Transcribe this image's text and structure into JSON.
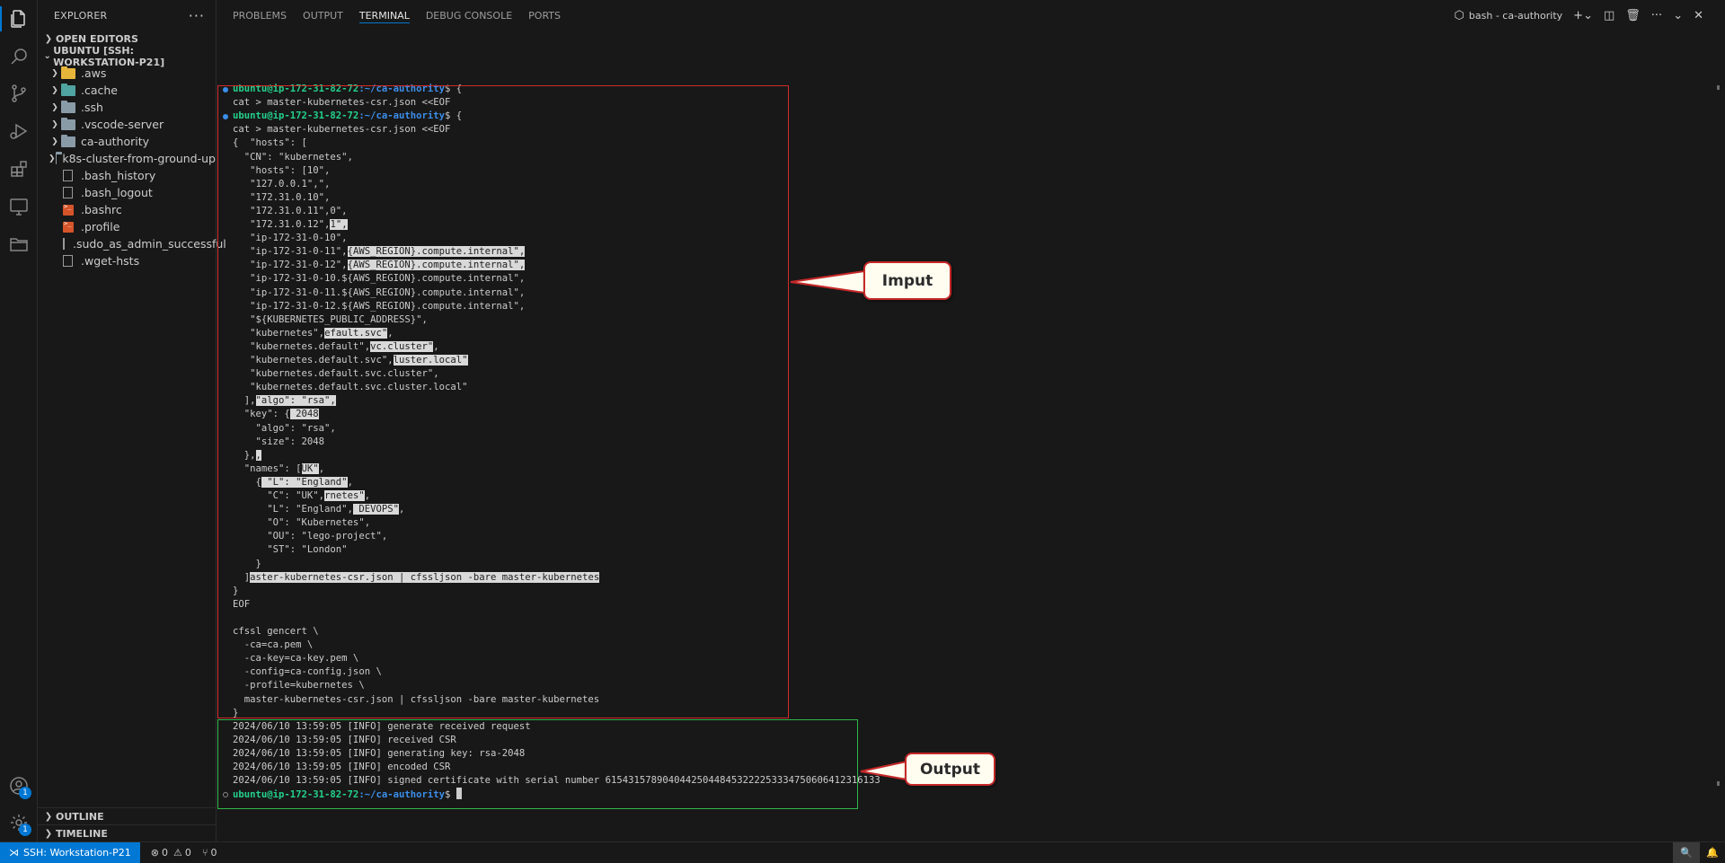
{
  "sidebar": {
    "title": "EXPLORER",
    "open_editors": "OPEN EDITORS",
    "workspace": "UBUNTU [SSH: WORKSTATION-P21]",
    "items": [
      {
        "label": ".aws",
        "kind": "folder",
        "icon": "folder-aws-icon"
      },
      {
        "label": ".cache",
        "kind": "folder",
        "icon": "folder-cache-icon"
      },
      {
        "label": ".ssh",
        "kind": "folder",
        "icon": "folder-icon"
      },
      {
        "label": ".vscode-server",
        "kind": "folder",
        "icon": "folder-icon"
      },
      {
        "label": "ca-authority",
        "kind": "folder",
        "icon": "folder-icon"
      },
      {
        "label": "k8s-cluster-from-ground-up",
        "kind": "folder",
        "icon": "folder-icon"
      },
      {
        "label": ".bash_history",
        "kind": "file",
        "icon": "file-icon"
      },
      {
        "label": ".bash_logout",
        "kind": "file",
        "icon": "file-icon"
      },
      {
        "label": ".bashrc",
        "kind": "shell",
        "icon": "shell-file-icon"
      },
      {
        "label": ".profile",
        "kind": "shell",
        "icon": "shell-file-icon"
      },
      {
        "label": ".sudo_as_admin_successful",
        "kind": "file",
        "icon": "file-icon"
      },
      {
        "label": ".wget-hsts",
        "kind": "file",
        "icon": "file-icon"
      }
    ],
    "outline": "OUTLINE",
    "timeline": "TIMELINE"
  },
  "activity": {
    "accounts_badge": "1",
    "settings_badge": "1"
  },
  "panel": {
    "tabs": [
      "PROBLEMS",
      "OUTPUT",
      "TERMINAL",
      "DEBUG CONSOLE",
      "PORTS"
    ],
    "active_tab": "TERMINAL",
    "terminal_name": "bash - ca-authority"
  },
  "terminal": {
    "user": "ubuntu@ip-172-31-82-72",
    "path": ":~/ca-authority",
    "lines": [
      {
        "t": "p",
        "cmd": "$ {"
      },
      {
        "t": "x",
        "s": [
          "cat > master-kubernetes-csr.json <<EOF"
        ]
      },
      {
        "t": "p",
        "cmd": "$ {"
      },
      {
        "t": "x",
        "s": [
          "cat > master-kubernetes-csr.json <<EOF"
        ]
      },
      {
        "t": "x",
        "s": [
          "{  \"hosts\": ["
        ]
      },
      {
        "t": "x",
        "s": [
          "  \"CN\": \"kubernetes\","
        ]
      },
      {
        "t": "x",
        "s": [
          "   \"hosts\": [10\","
        ]
      },
      {
        "t": "x",
        "s": [
          "   \"127.0.0.1\",\","
        ]
      },
      {
        "t": "x",
        "s": [
          "   \"172.31.0.10\","
        ]
      },
      {
        "t": "x",
        "s": [
          "   \"172.31.0.11\",0\","
        ]
      },
      {
        "t": "x",
        "s": [
          "   \"172.31.0.12\",",
          {
            "h": "1\","
          }
        ]
      },
      {
        "t": "x",
        "s": [
          "   \"ip-172-31-0-10\","
        ]
      },
      {
        "t": "x",
        "s": [
          "   \"ip-172-31-0-11\",",
          {
            "h": "{AWS_REGION}.compute.internal\","
          }
        ]
      },
      {
        "t": "x",
        "s": [
          "   \"ip-172-31-0-12\",",
          {
            "h": "{AWS_REGION}.compute.internal\","
          }
        ]
      },
      {
        "t": "x",
        "s": [
          "   \"ip-172-31-0-10.${AWS_REGION}.compute.internal\","
        ]
      },
      {
        "t": "x",
        "s": [
          "   \"ip-172-31-0-11.${AWS_REGION}.compute.internal\","
        ]
      },
      {
        "t": "x",
        "s": [
          "   \"ip-172-31-0-12.${AWS_REGION}.compute.internal\","
        ]
      },
      {
        "t": "x",
        "s": [
          "   \"${KUBERNETES_PUBLIC_ADDRESS}\","
        ]
      },
      {
        "t": "x",
        "s": [
          "   \"kubernetes\",",
          {
            "h": "efault.svc\""
          },
          ","
        ]
      },
      {
        "t": "x",
        "s": [
          "   \"kubernetes.default\",",
          {
            "h": "vc.cluster\""
          },
          ","
        ]
      },
      {
        "t": "x",
        "s": [
          "   \"kubernetes.default.svc\",",
          {
            "h": "luster.local\""
          }
        ]
      },
      {
        "t": "x",
        "s": [
          "   \"kubernetes.default.svc.cluster\","
        ]
      },
      {
        "t": "x",
        "s": [
          "   \"kubernetes.default.svc.cluster.local\""
        ]
      },
      {
        "t": "x",
        "s": [
          "  ],",
          {
            "h": "\"algo\": \"rsa\","
          }
        ]
      },
      {
        "t": "x",
        "s": [
          "  \"key\": {",
          {
            "h": " 2048"
          }
        ]
      },
      {
        "t": "x",
        "s": [
          "    \"algo\": \"rsa\","
        ]
      },
      {
        "t": "x",
        "s": [
          "    \"size\": 2048"
        ]
      },
      {
        "t": "x",
        "s": [
          "  },",
          {
            "h": ","
          }
        ]
      },
      {
        "t": "x",
        "s": [
          "  \"names\": [",
          {
            "h": "UK\""
          },
          ","
        ]
      },
      {
        "t": "x",
        "s": [
          "    {",
          {
            "h": " \"L\": \"England\""
          },
          ","
        ]
      },
      {
        "t": "x",
        "s": [
          "      \"C\": \"UK\",",
          {
            "h": "rnetes\""
          },
          ","
        ]
      },
      {
        "t": "x",
        "s": [
          "      \"L\": \"England\",",
          {
            "h": " DEVOPS\""
          },
          ","
        ]
      },
      {
        "t": "x",
        "s": [
          "      \"O\": \"Kubernetes\","
        ]
      },
      {
        "t": "x",
        "s": [
          "      \"OU\": \"lego-project\","
        ]
      },
      {
        "t": "x",
        "s": [
          "      \"ST\": \"London\""
        ]
      },
      {
        "t": "x",
        "s": [
          "    }"
        ]
      },
      {
        "t": "x",
        "s": [
          "  ]",
          {
            "h": "aster-kubernetes-csr.json | cfssljson -bare master-kubernetes"
          }
        ]
      },
      {
        "t": "x",
        "s": [
          "}"
        ]
      },
      {
        "t": "x",
        "s": [
          "EOF"
        ]
      },
      {
        "t": "x",
        "s": [
          ""
        ]
      },
      {
        "t": "x",
        "s": [
          "cfssl gencert \\"
        ]
      },
      {
        "t": "x",
        "s": [
          "  -ca=ca.pem \\"
        ]
      },
      {
        "t": "x",
        "s": [
          "  -ca-key=ca-key.pem \\"
        ]
      },
      {
        "t": "x",
        "s": [
          "  -config=ca-config.json \\"
        ]
      },
      {
        "t": "x",
        "s": [
          "  -profile=kubernetes \\"
        ]
      },
      {
        "t": "x",
        "s": [
          "  master-kubernetes-csr.json | cfssljson -bare master-kubernetes"
        ]
      },
      {
        "t": "x",
        "s": [
          "}"
        ]
      },
      {
        "t": "x",
        "s": [
          "2024/06/10 13:59:05 [INFO] generate received request"
        ]
      },
      {
        "t": "x",
        "s": [
          "2024/06/10 13:59:05 [INFO] received CSR"
        ]
      },
      {
        "t": "x",
        "s": [
          "2024/06/10 13:59:05 [INFO] generating key: rsa-2048"
        ]
      },
      {
        "t": "x",
        "s": [
          "2024/06/10 13:59:05 [INFO] encoded CSR"
        ]
      },
      {
        "t": "x",
        "s": [
          "2024/06/10 13:59:05 [INFO] signed certificate with serial number 615431578904044250448453222253334750606412316133"
        ]
      },
      {
        "t": "p",
        "cmd": "$ ",
        "cursor": true
      }
    ]
  },
  "annotations": {
    "input_label": "Imput",
    "output_label": "Output",
    "input_color": "#d22a2a",
    "output_color": "#2fb84a"
  },
  "statusbar": {
    "remote": "SSH: Workstation-P21",
    "errors": "0",
    "warnings": "0",
    "ports": "0"
  },
  "colors": {
    "background": "#181818",
    "accent": "#0078d4",
    "prompt_user": "#23d18b",
    "prompt_path": "#3b8eea"
  }
}
